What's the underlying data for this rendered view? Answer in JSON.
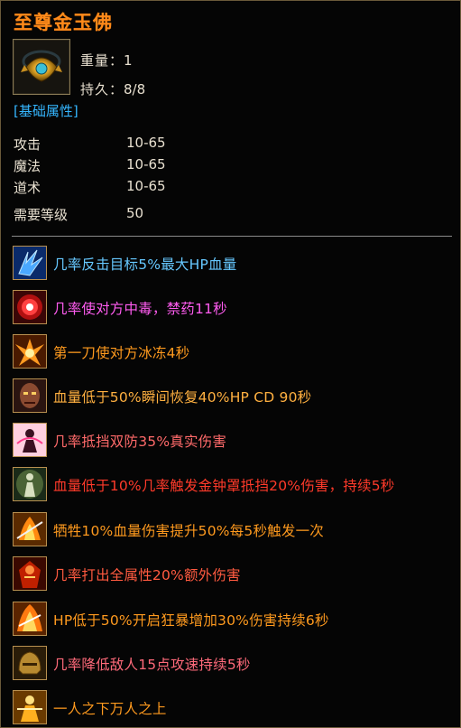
{
  "item": {
    "name": "至尊金玉佛",
    "icon": "golden-buddha-necklace-icon",
    "weight_label": "重量：",
    "weight_value": "1",
    "durability_label": "持久：",
    "durability_value": "8/8"
  },
  "basic_section_title": "[基础属性]",
  "attributes": [
    {
      "name": "攻击",
      "value": "10-65"
    },
    {
      "name": "魔法",
      "value": "10-65"
    },
    {
      "name": "道术",
      "value": "10-65"
    },
    {
      "name": "需要等级",
      "value": "50"
    }
  ],
  "skills": [
    {
      "icon": "blue-claw-icon",
      "text": "几率反击目标5%最大HP血量",
      "color": "#66c8ff"
    },
    {
      "icon": "red-target-icon",
      "text": "几率使对方中毒，禁药11秒",
      "color": "#ff5cf0"
    },
    {
      "icon": "fire-burst-icon",
      "text": "第一刀使对方冰冻4秒",
      "color": "#ff9a1e"
    },
    {
      "icon": "warrior-face-icon",
      "text": "血量低于50%瞬间恢复40%HP CD 90秒",
      "color": "#ffb040"
    },
    {
      "icon": "pink-figure-icon",
      "text": "几率抵挡双防35%真实伤害",
      "color": "#ff6a6a"
    },
    {
      "icon": "green-shield-figure-icon",
      "text": "血量低于10%几率触发金钟罩抵挡20%伤害，持续5秒",
      "color": "#ff3a2a"
    },
    {
      "icon": "flame-sword-icon",
      "text": "牺牲10%血量伤害提升50%每5秒触发一次",
      "color": "#ff9a1e"
    },
    {
      "icon": "red-warrior-icon",
      "text": "几率打出全属性20%额外伤害",
      "color": "#ff5a40"
    },
    {
      "icon": "berserk-flame-icon",
      "text": "HP低于50%开启狂暴增加30%伤害持续6秒",
      "color": "#ff9a1e"
    },
    {
      "icon": "bronze-helmet-icon",
      "text": "几率降低敌人15点攻速持续5秒",
      "color": "#ff6a7a"
    },
    {
      "icon": "golden-warrior-icon",
      "text": "一人之下万人之上",
      "color": "#ff9a1e"
    }
  ]
}
